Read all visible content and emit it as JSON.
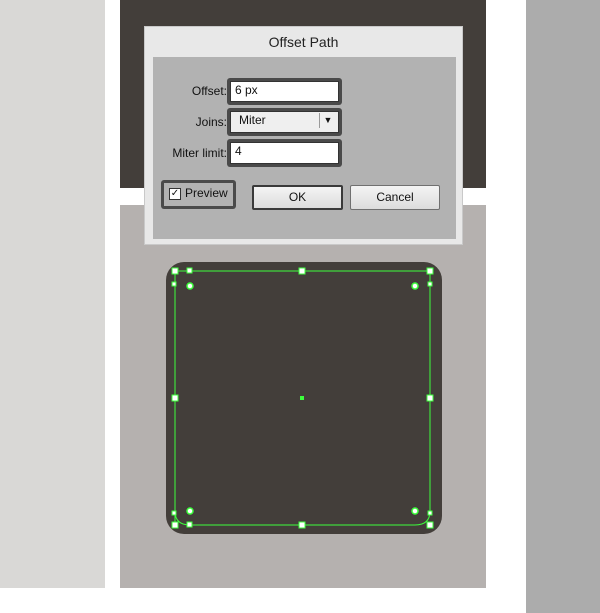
{
  "dialog": {
    "title": "Offset Path",
    "offset_label": "Offset:",
    "offset_value": "6 px",
    "joins_label": "Joins:",
    "joins_value": "Miter",
    "miter_label": "Miter limit:",
    "miter_value": "4",
    "preview_label": "Preview",
    "preview_checked": true,
    "ok_label": "OK",
    "cancel_label": "Cancel"
  },
  "artwork": {
    "shape_color": "#433e3a",
    "path_color": "#3cff3c",
    "canvas_color": "#b5b1af"
  }
}
